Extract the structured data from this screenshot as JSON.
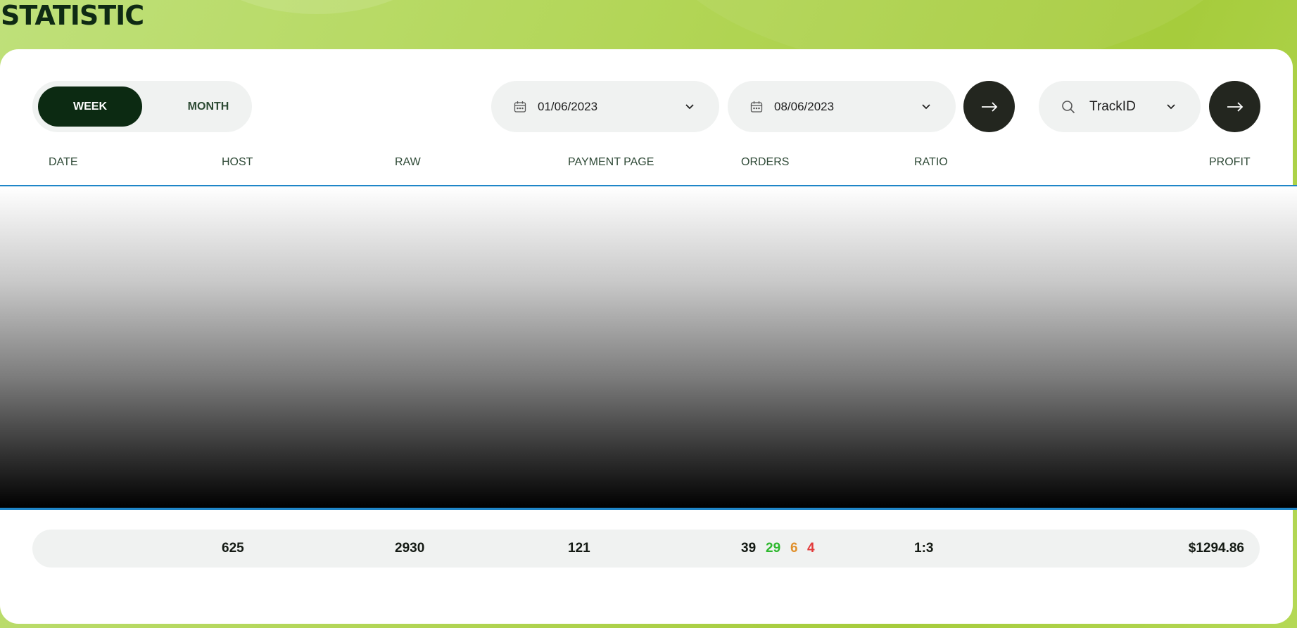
{
  "page": {
    "title": "STATISTIC"
  },
  "period_toggle": {
    "week_label": "WEEK",
    "month_label": "MONTH",
    "active": "WEEK"
  },
  "filters": {
    "date_from": "01/06/2023",
    "date_to": "08/06/2023",
    "search_value": "TrackID"
  },
  "table": {
    "columns": [
      "DATE",
      "HOST",
      "RAW",
      "PAYMENT PAGE",
      "ORDERS",
      "RATIO",
      "PROFIT"
    ]
  },
  "totals": {
    "host": "625",
    "raw": "2930",
    "payment_page": "121",
    "orders_total": "39",
    "orders_green": "29",
    "orders_orange": "6",
    "orders_red": "4",
    "ratio": "1:3",
    "profit": "$1294.86"
  },
  "colors": {
    "active_toggle": "#0c2a12",
    "go_button": "#23261f",
    "divider": "#1f86c8",
    "orders_green": "#2eb82e",
    "orders_orange": "#e0902c",
    "orders_red": "#e23b3b"
  }
}
